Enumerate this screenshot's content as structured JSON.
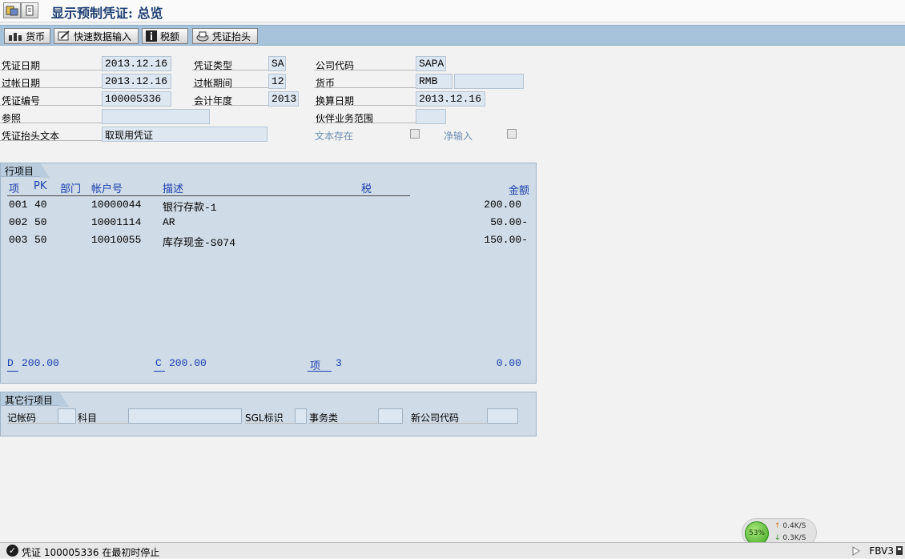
{
  "window": {
    "title": "显示预制凭证: 总览"
  },
  "toolbar": [
    {
      "label": "货币",
      "icon": "currency-icon"
    },
    {
      "label": "快速数据输入",
      "icon": "fast-entry-icon"
    },
    {
      "label": "税额",
      "icon": "info-icon"
    },
    {
      "label": "凭证抬头",
      "icon": "document-header-icon"
    }
  ],
  "header": {
    "doc_date_label": "凭证日期",
    "doc_date": "2013.12.16",
    "doc_type_label": "凭证类型",
    "doc_type": "SA",
    "company_code_label": "公司代码",
    "company_code": "SAPA",
    "posting_date_label": "过帐日期",
    "posting_date": "2013.12.16",
    "period_label": "过帐期间",
    "period": "12",
    "currency_label": "货币",
    "currency": "RMB",
    "currency_extra": "",
    "doc_number_label": "凭证编号",
    "doc_number": "100005336",
    "fiscal_year_label": "会计年度",
    "fiscal_year": "2013",
    "translation_date_label": "换算日期",
    "translation_date": "2013.12.16",
    "reference_label": "参照",
    "reference": "",
    "partner_area_label": "伙伴业务范围",
    "partner_area": "",
    "header_text_label": "凭证抬头文本",
    "header_text": "取现用凭证",
    "text_exists_label": "文本存在",
    "net_entry_label": "净输入"
  },
  "items_panel": {
    "title": "行项目",
    "columns": {
      "item": "项",
      "pk": "PK",
      "dept": "部门",
      "account": "帐户号",
      "desc": "描述",
      "tax": "税",
      "amount": "金额"
    },
    "rows": [
      {
        "item": "001",
        "pk": "40",
        "account": "10000044",
        "desc": "银行存款-1",
        "amount": "200.00"
      },
      {
        "item": "002",
        "pk": "50",
        "account": "10001114",
        "desc": "AR",
        "amount": "50.00-"
      },
      {
        "item": "003",
        "pk": "50",
        "account": "10010055",
        "desc": "库存现金-S074",
        "amount": "150.00-"
      }
    ],
    "totals": {
      "d_label": "D",
      "d_value": "200.00",
      "c_label": "C",
      "c_value": "200.00",
      "items_label": "项",
      "items_value": "3",
      "balance": "0.00"
    }
  },
  "other_panel": {
    "title": "其它行项目",
    "posting_key_label": "记帐码",
    "account_label": "科目",
    "sgl_label": "SGL标识",
    "trans_type_label": "事务类",
    "new_company_label": "新公司代码"
  },
  "status": {
    "message": "凭证 100005336 在最初时停止",
    "tcode": "FBV3"
  },
  "network": {
    "percent": "53%",
    "up": "0.4K/S",
    "down": "0.3K/S"
  }
}
